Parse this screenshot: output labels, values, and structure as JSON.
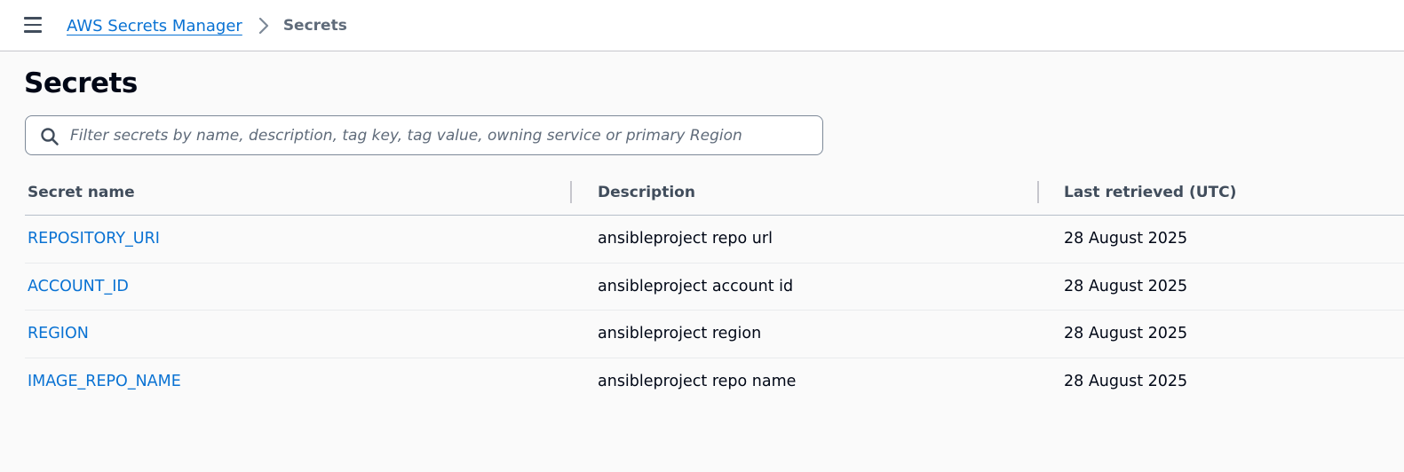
{
  "breadcrumb": {
    "service_label": "AWS Secrets Manager",
    "current_label": "Secrets"
  },
  "page": {
    "title": "Secrets"
  },
  "search": {
    "placeholder": "Filter secrets by name, description, tag key, tag value, owning service or primary Region",
    "value": ""
  },
  "table": {
    "columns": [
      "Secret name",
      "Description",
      "Last retrieved (UTC)"
    ],
    "rows": [
      {
        "name": "REPOSITORY_URI",
        "description": "ansibleproject repo url",
        "last_retrieved": "28 August 2025"
      },
      {
        "name": "ACCOUNT_ID",
        "description": "ansibleproject account id",
        "last_retrieved": "28 August 2025"
      },
      {
        "name": "REGION",
        "description": "ansibleproject region",
        "last_retrieved": "28 August 2025"
      },
      {
        "name": "IMAGE_REPO_NAME",
        "description": "ansibleproject repo name",
        "last_retrieved": "28 August 2025"
      }
    ]
  },
  "icons": {
    "menu": "hamburger-menu-icon",
    "breadcrumb_separator": "chevron-right-icon",
    "search": "search-icon"
  },
  "colors": {
    "link": "#0972d3",
    "heading": "#000716",
    "muted": "#5f6b7a",
    "background": "#fafafa"
  }
}
